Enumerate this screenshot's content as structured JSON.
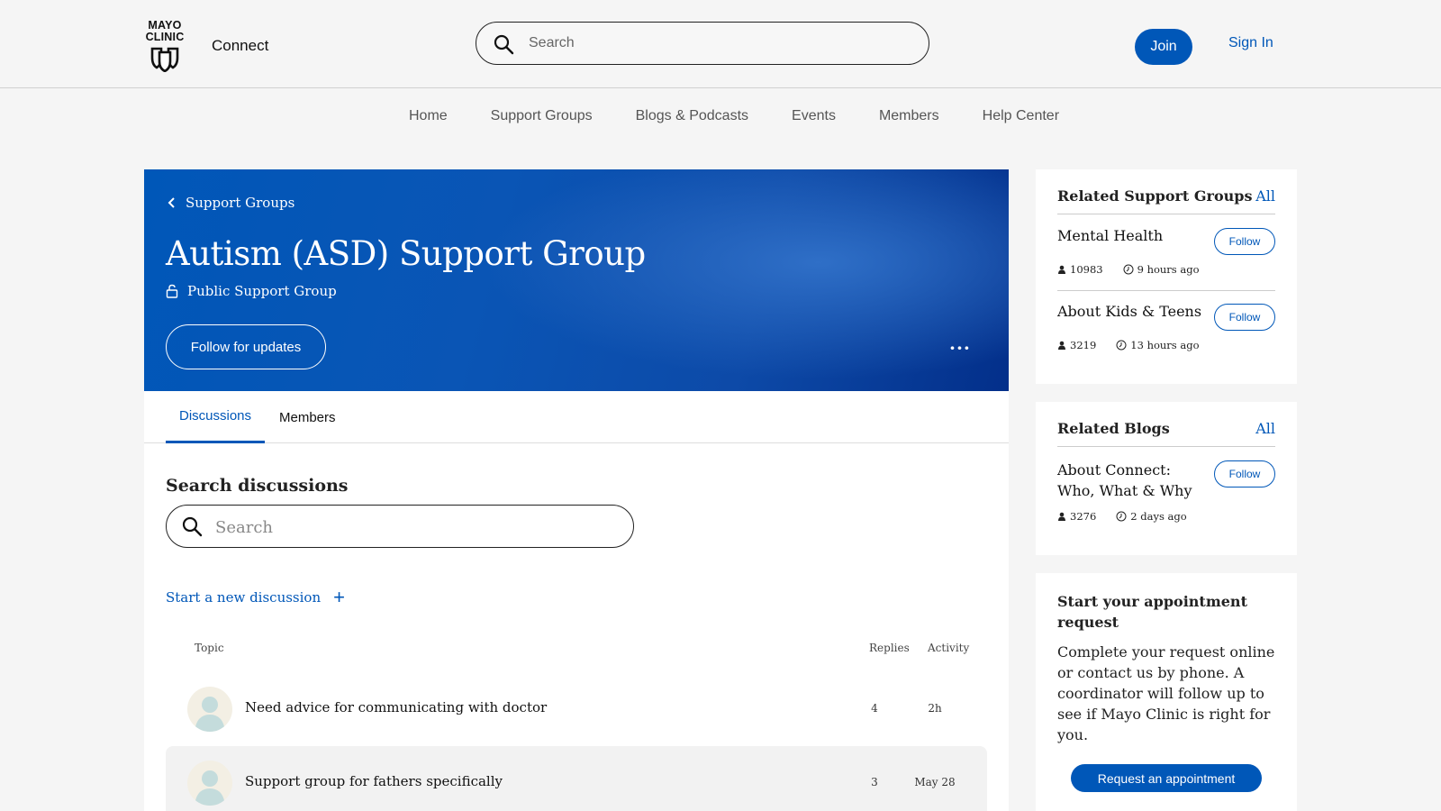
{
  "header": {
    "logo_text": "MAYO CLINIC",
    "logo_line1": "MAYO",
    "logo_line2": "CLINIC",
    "brand": "Connect",
    "search_placeholder": "Search",
    "join_label": "Join",
    "signin_label": "Sign In"
  },
  "nav": {
    "items": [
      "Home",
      "Support Groups",
      "Blogs & Podcasts",
      "Events",
      "Members",
      "Help Center"
    ]
  },
  "hero": {
    "breadcrumb": "Support Groups",
    "title": "Autism (ASD) Support Group",
    "visibility": "Public Support Group",
    "follow_label": "Follow for updates",
    "more_label": "···"
  },
  "tabs": [
    "Discussions",
    "Members"
  ],
  "discussions": {
    "search_title": "Search discussions",
    "search_placeholder": "Search",
    "new_discussion": "Start a new discussion",
    "columns": {
      "topic": "Topic",
      "replies": "Replies",
      "activity": "Activity"
    },
    "rows": [
      {
        "topic": "Need advice for communicating with doctor",
        "replies": "4",
        "activity": "2h"
      },
      {
        "topic": "Support group for fathers specifically",
        "replies": "3",
        "activity": "May 28"
      }
    ]
  },
  "related_groups": {
    "title": "Related Support Groups",
    "all_label": "All",
    "items": [
      {
        "name": "Mental Health",
        "members": "10983",
        "time": "9 hours ago",
        "follow": "Follow"
      },
      {
        "name": "About Kids & Teens",
        "members": "3219",
        "time": "13 hours ago",
        "follow": "Follow"
      }
    ]
  },
  "related_blogs": {
    "title": "Related Blogs",
    "all_label": "All",
    "items": [
      {
        "name": "About Connect: Who, What & Why",
        "members": "3276",
        "time": "2 days ago",
        "follow": "Follow"
      }
    ]
  },
  "appointment": {
    "title": "Start your appointment request",
    "body": "Complete your request online or contact us by phone. A coordinator will follow up to see if Mayo Clinic is right for you.",
    "button": "Request an appointment"
  },
  "colors": {
    "accent": "#0057b8",
    "hero_dark": "#032f8a",
    "background": "#f5f5f5"
  }
}
